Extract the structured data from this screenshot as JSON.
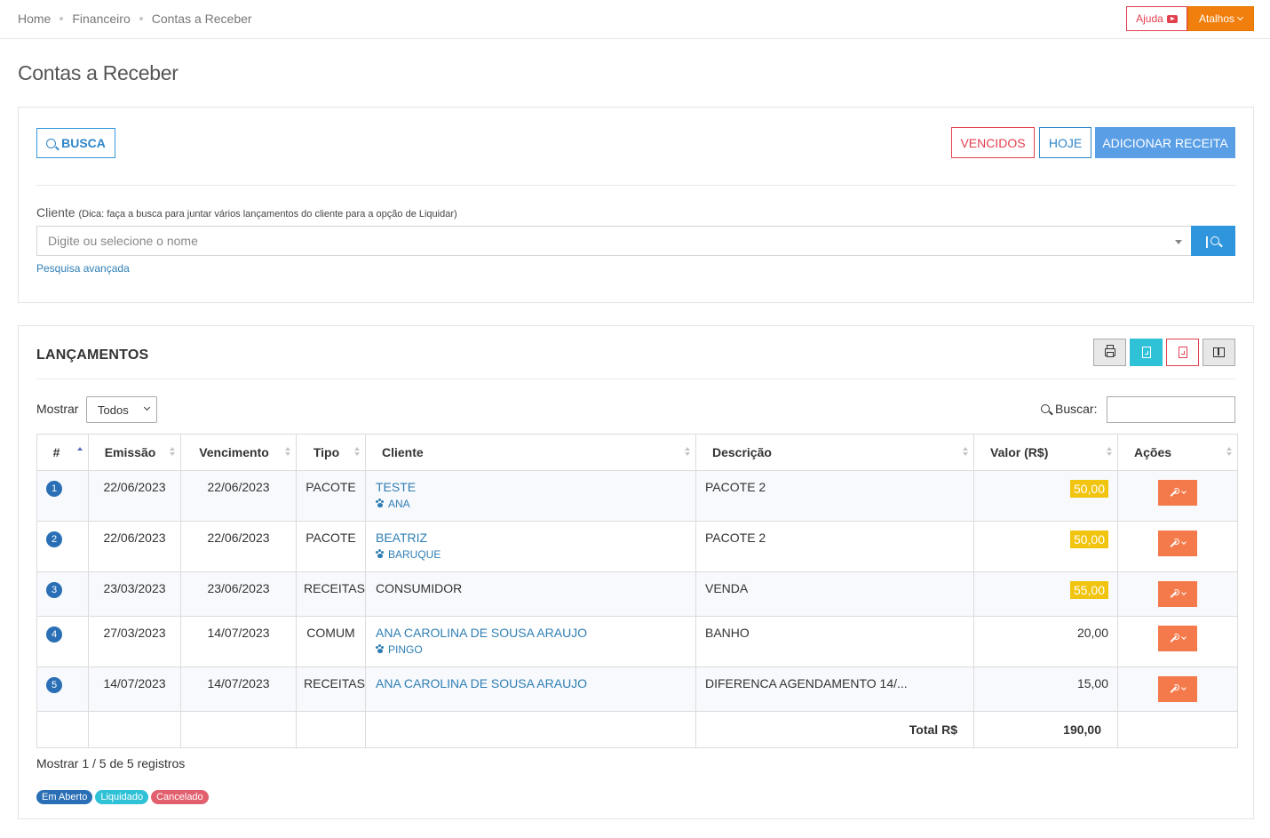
{
  "breadcrumb": [
    "Home",
    "Financeiro",
    "Contas a Receber"
  ],
  "header": {
    "help_label": "Ajuda",
    "shortcuts_label": "Atalhos"
  },
  "page_title": "Contas a Receber",
  "search_panel": {
    "busca_label": "BUSCA",
    "vencidos_label": "VENCIDOS",
    "hoje_label": "HOJE",
    "add_label": "ADICIONAR RECEITA",
    "client_label": "Cliente",
    "client_hint": "(Dica: faça a busca para juntar vários lançamentos do cliente para a opção de Liquidar)",
    "client_placeholder": "Digite ou selecione o nome",
    "client_search_btn": "|",
    "advanced_link": "Pesquisa avançada"
  },
  "list": {
    "title": "LANÇAMENTOS",
    "show_label": "Mostrar",
    "show_value": "Todos",
    "search_label": "Buscar:",
    "columns": [
      "#",
      "Emissão",
      "Vencimento",
      "Tipo",
      "Cliente",
      "Descrição",
      "Valor (R$)",
      "Ações"
    ],
    "rows": [
      {
        "n": "1",
        "emissao": "22/06/2023",
        "vencimento": "22/06/2023",
        "tipo": "PACOTE",
        "cliente": "TESTE",
        "pet": "ANA",
        "descricao": "PACOTE 2",
        "valor": "50,00",
        "open": true
      },
      {
        "n": "2",
        "emissao": "22/06/2023",
        "vencimento": "22/06/2023",
        "tipo": "PACOTE",
        "cliente": "BEATRIZ",
        "pet": "BARUQUE",
        "descricao": "PACOTE 2",
        "valor": "50,00",
        "open": true
      },
      {
        "n": "3",
        "emissao": "23/03/2023",
        "vencimento": "23/06/2023",
        "tipo": "RECEITAS",
        "cliente": "CONSUMIDOR",
        "pet": "",
        "descricao": "VENDA",
        "valor": "55,00",
        "open": true
      },
      {
        "n": "4",
        "emissao": "27/03/2023",
        "vencimento": "14/07/2023",
        "tipo": "COMUM",
        "cliente": "ANA CAROLINA DE SOUSA ARAUJO",
        "pet": "PINGO",
        "descricao": "BANHO",
        "valor": "20,00",
        "open": false
      },
      {
        "n": "5",
        "emissao": "14/07/2023",
        "vencimento": "14/07/2023",
        "tipo": "RECEITAS",
        "cliente": "ANA CAROLINA DE SOUSA ARAUJO",
        "pet": "",
        "descricao": "DIFERENCA AGENDAMENTO 14/...",
        "valor": "15,00",
        "open": false
      }
    ],
    "total_label": "Total R$",
    "total_value": "190,00",
    "records_text": "Mostrar 1 / 5 de 5 registros",
    "legend": [
      {
        "label": "Em Aberto",
        "color": "#2a6fb5"
      },
      {
        "label": "Liquidado",
        "color": "#2fc1d6"
      },
      {
        "label": "Cancelado",
        "color": "#e2606e"
      }
    ]
  },
  "icons": {
    "help": "youtube-play-icon",
    "print": "print-icon",
    "excel": "file-excel-icon",
    "pdf": "file-pdf-icon",
    "columns": "columns-icon",
    "pet": "paw-icon",
    "actions": "wrench-icon"
  },
  "colors": {
    "accent_blue": "#2f86c9",
    "danger": "#e2404f",
    "warning_badge": "#f1c40f",
    "action_orange": "#f57a4b",
    "shortcut_orange": "#f07f0d"
  }
}
